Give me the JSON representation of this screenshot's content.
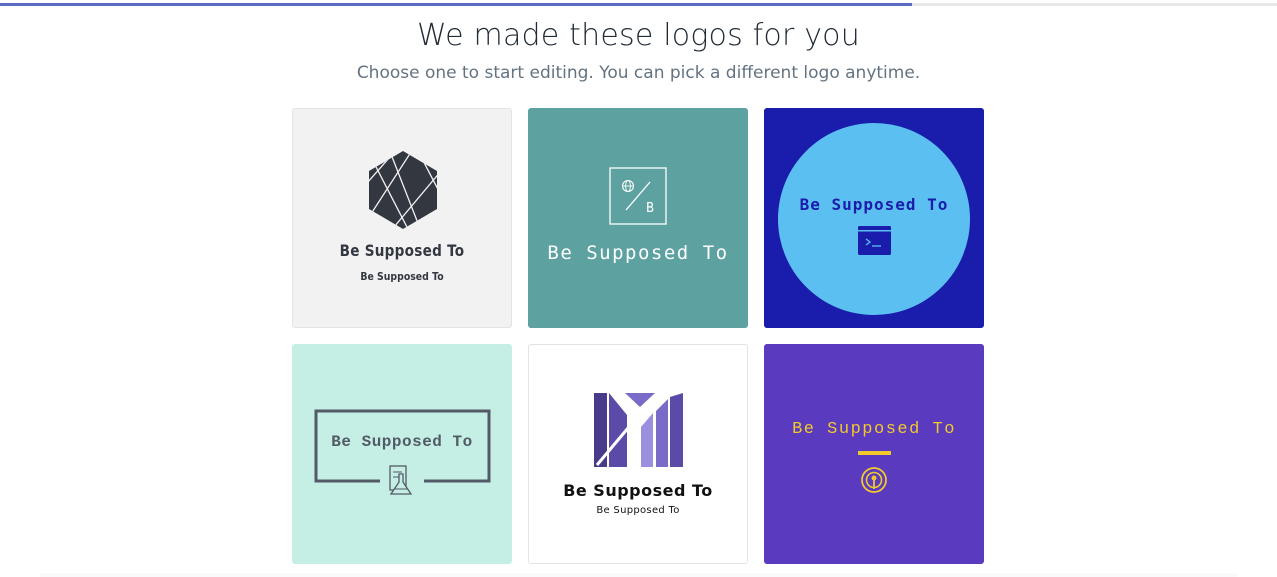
{
  "progress": {
    "percent": 71.4
  },
  "header": {
    "title": "We made these logos for you",
    "subtitle": "Choose one to start editing. You can pick a different logo anytime."
  },
  "logos": [
    {
      "name": "Be Supposed To",
      "tagline": "Be Supposed To",
      "icon": "hexagon-lines-icon",
      "background": "#f2f2f2",
      "text_color": "#333740"
    },
    {
      "name": "Be Supposed To",
      "icon_letter": "B",
      "icon": "globe-slash-icon",
      "background": "#5ea1a1",
      "text_color": "#ffffff"
    },
    {
      "name": "Be Supposed To",
      "icon": "terminal-window-icon",
      "background": "#1a1cab",
      "circle_color": "#5bbff2",
      "text_color": "#1a1cab"
    },
    {
      "name": "Be Supposed To",
      "icon": "lab-flask-icon",
      "background": "#c5efe5",
      "text_color": "#525a66"
    },
    {
      "name": "Be Supposed To",
      "tagline": "Be Supposed To",
      "icon": "m-stripes-icon",
      "background": "#ffffff",
      "text_color": "#111111"
    },
    {
      "name": "Be Supposed To",
      "icon": "podcast-icon",
      "background": "#5a3abf",
      "text_color": "#f2c92b"
    }
  ]
}
